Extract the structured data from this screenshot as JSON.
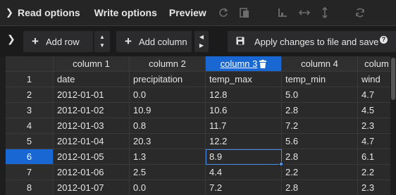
{
  "menu": {
    "read_options": "Read options",
    "write_options": "Write options",
    "preview": "Preview"
  },
  "toolbar": {
    "add_row": "Add row",
    "add_column": "Add column",
    "apply_save": "Apply changes to file and save",
    "help": "?"
  },
  "grid": {
    "columns": [
      "column 1",
      "column 2",
      "column 3",
      "column 4",
      "colum"
    ],
    "row_numbers": [
      "1",
      "2",
      "3",
      "4",
      "5",
      "6",
      "7",
      "8"
    ],
    "rows": [
      [
        "date",
        "precipitation",
        "temp_max",
        "temp_min",
        "wind"
      ],
      [
        "2012-01-01",
        "0.0",
        "12.8",
        "5.0",
        "4.7"
      ],
      [
        "2012-01-02",
        "10.9",
        "10.6",
        "2.8",
        "4.5"
      ],
      [
        "2012-01-03",
        "0.8",
        "11.7",
        "7.2",
        "2.3"
      ],
      [
        "2012-01-04",
        "20.3",
        "12.2",
        "5.6",
        "4.7"
      ],
      [
        "2012-01-05",
        "1.3",
        "8.9",
        "2.8",
        "6.1"
      ],
      [
        "2012-01-06",
        "2.5",
        "4.4",
        "2.2",
        "2.2"
      ],
      [
        "2012-01-07",
        "0.0",
        "7.2",
        "2.8",
        "2.3"
      ]
    ],
    "selected_row": "6",
    "selected_column": "column 3",
    "active_cell_value": "8.9"
  },
  "colors": {
    "selection": "#1967d2",
    "active_outline": "#4a8fe8"
  }
}
